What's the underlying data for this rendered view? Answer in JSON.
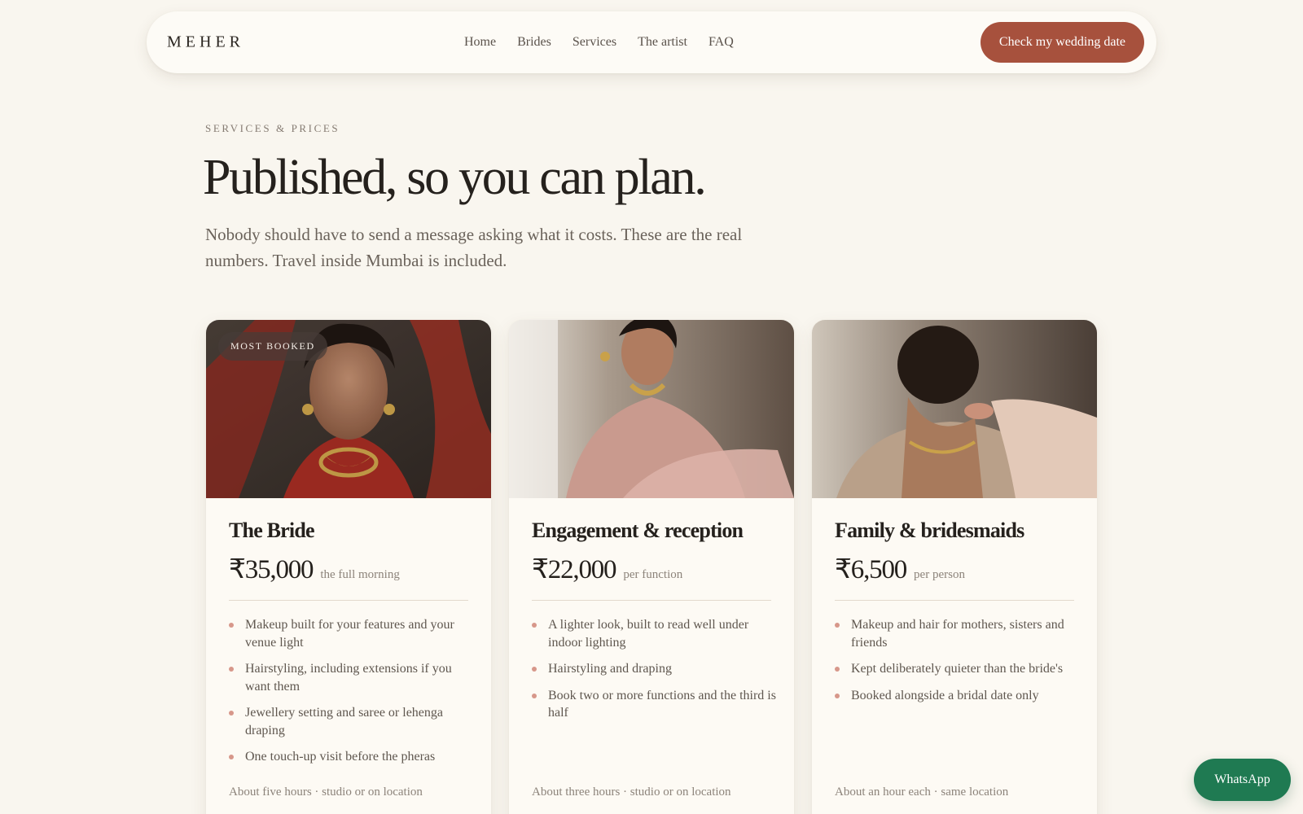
{
  "nav": {
    "brand": "MEHER",
    "links": [
      "Home",
      "Brides",
      "Services",
      "The artist",
      "FAQ"
    ],
    "cta_label": "Check my wedding date"
  },
  "hero": {
    "eyebrow": "SERVICES & PRICES",
    "headline": "Published, so you can plan.",
    "lede": "Nobody should have to send a message asking what it costs. These are the real numbers. Travel inside Mumbai is included."
  },
  "cards": [
    {
      "badge": "MOST BOOKED",
      "title": "The Bride",
      "price": "₹35,000",
      "unit": "the full morning",
      "features": [
        "Makeup built for your features and your venue light",
        "Hairstyling, including extensions if you want them",
        "Jewellery setting and saree or lehenga draping",
        "One touch-up visit before the pheras"
      ],
      "footnote": "About five hours · studio or on location"
    },
    {
      "title": "Engagement & reception",
      "price": "₹22,000",
      "unit": "per function",
      "features": [
        "A lighter look, built to read well under indoor lighting",
        "Hairstyling and draping",
        "Book two or more functions and the third is half"
      ],
      "footnote": "About three hours · studio or on location"
    },
    {
      "title": "Family & bridesmaids",
      "price": "₹6,500",
      "unit": "per person",
      "features": [
        "Makeup and hair for mothers, sisters and friends",
        "Kept deliberately quieter than the bride's",
        "Booked alongside a bridal date only"
      ],
      "footnote": "About an hour each · same location"
    }
  ],
  "whatsapp": {
    "label": "WhatsApp"
  },
  "colors": {
    "background": "#f9f6ef",
    "accent": "#a7513d",
    "whatsapp": "#1f7a52",
    "bullet": "#d7978a"
  }
}
